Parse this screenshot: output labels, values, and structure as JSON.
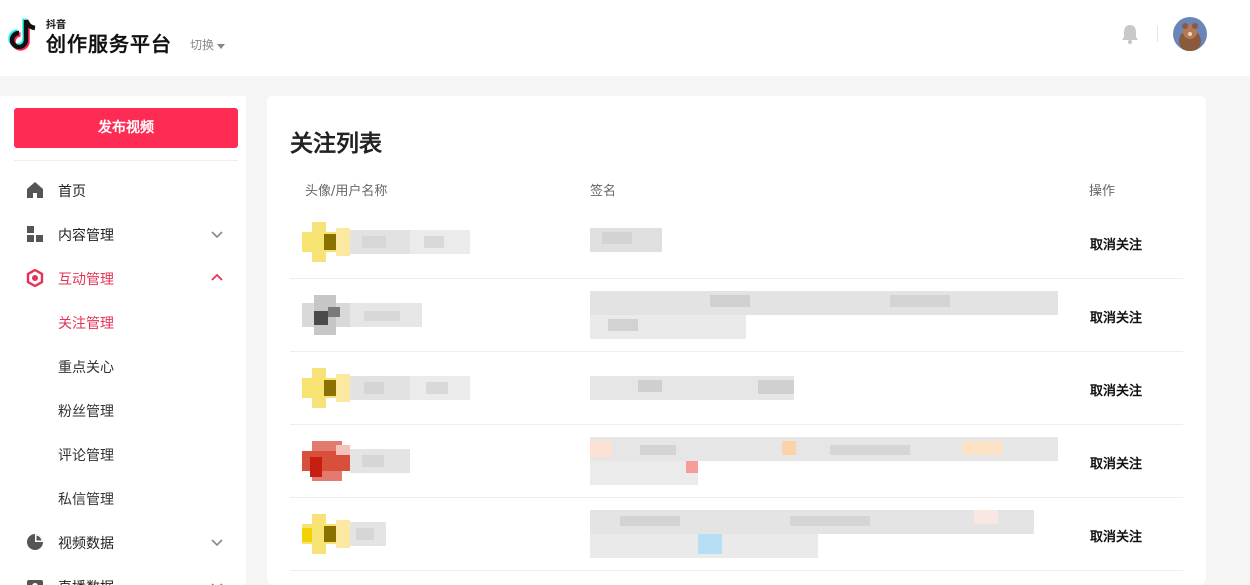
{
  "header": {
    "app_small": "抖音",
    "app_title": "创作服务平台",
    "switch_label": "切换"
  },
  "sidebar": {
    "publish_label": "发布视频",
    "items": [
      {
        "label": "首页",
        "icon": "home-icon"
      },
      {
        "label": "内容管理",
        "icon": "grid-icon"
      },
      {
        "label": "互动管理",
        "icon": "interaction-icon",
        "expanded": true
      },
      {
        "label": "视频数据",
        "icon": "pie-chart-icon"
      },
      {
        "label": "直播数据",
        "icon": "live-icon"
      }
    ],
    "sub_items": [
      {
        "label": "关注管理"
      },
      {
        "label": "重点关心"
      },
      {
        "label": "粉丝管理"
      },
      {
        "label": "评论管理"
      },
      {
        "label": "私信管理"
      }
    ]
  },
  "main": {
    "title": "关注列表",
    "columns": [
      "头像/用户名称",
      "签名",
      "操作"
    ],
    "action_label": "取消关注"
  },
  "colors": {
    "brand": "#fe2c55",
    "active": "#e63355",
    "background": "#f5f5f6"
  }
}
